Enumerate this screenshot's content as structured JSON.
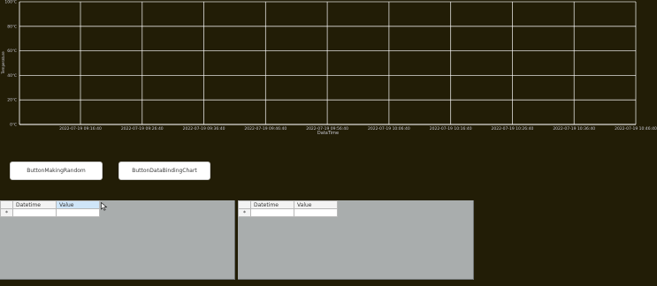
{
  "chart_data": {
    "type": "line",
    "xlabel": "DataTime",
    "ylabel": "Temperature",
    "y_ticks": [
      "100℃",
      "80℃",
      "60℃",
      "40℃",
      "20℃",
      "0℃"
    ],
    "x_ticks": [
      "2022-07-19 09:16:40",
      "2022-07-19 09:26:40",
      "2022-07-19 09:36:40",
      "2022-07-19 09:46:40",
      "2022-07-19 09:56:40",
      "2022-07-19 10:06:40",
      "2022-07-19 10:16:40",
      "2022-07-19 10:26:40",
      "2022-07-19 10:36:40",
      "2022-07-19 10:46:40"
    ],
    "ylim": [
      0,
      100
    ],
    "grid": true,
    "series": [],
    "colors": {
      "background": "#221d06",
      "grid": "#ffffff",
      "text": "#c9c9d4"
    }
  },
  "buttons": {
    "making_random": "ButtonMakingRandom",
    "databinding_chart": "ButtonDataBindingChart"
  },
  "grid1": {
    "columns": [
      "Datetime",
      "Value"
    ],
    "new_row_marker": "*"
  },
  "grid2": {
    "columns": [
      "Datetime",
      "Value"
    ],
    "new_row_marker": "*"
  }
}
